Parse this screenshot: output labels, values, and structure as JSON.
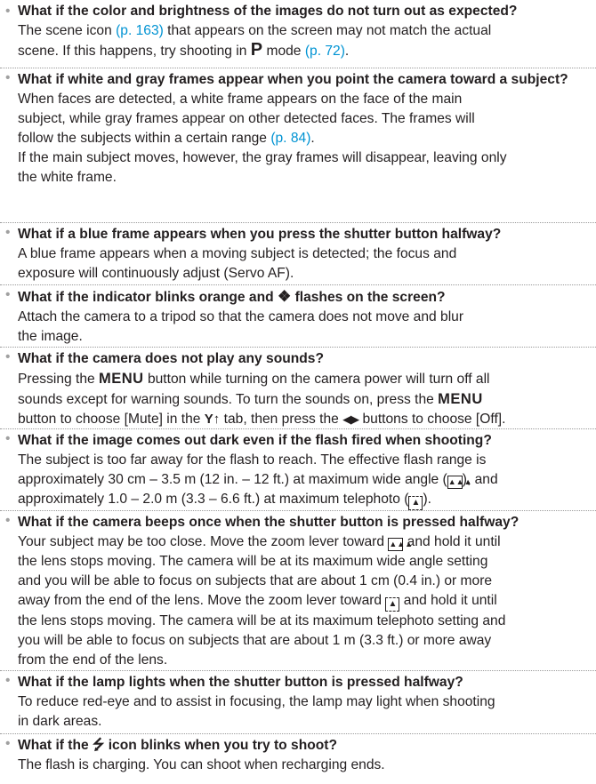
{
  "bullet_glyph": "•",
  "items": [
    {
      "question": "What if the color and brightness of the images do not turn out as expected?",
      "answer_l1_a": "The scene icon ",
      "answer_l1_link": "(p. 163)",
      "answer_l1_b": " that appears on the screen may not match the actual",
      "answer_l2_a": "scene. If this happens, try shooting in ",
      "answer_l2_mode": "P",
      "answer_l2_b": " mode ",
      "answer_l2_link": "(p. 72)",
      "answer_l2_c": "."
    },
    {
      "question": "What if white and gray frames appear when you point the camera toward a subject?",
      "answer_l1": "When faces are detected, a white frame appears on the face of the main",
      "answer_l2": "subject, while gray frames appear on other detected faces. The frames will",
      "answer_l3_a": "follow the subjects within a certain range ",
      "answer_l3_link": "(p. 84)",
      "answer_l3_b": ".",
      "answer_l4": "If the main subject moves, however, the gray frames will disappear, leaving only",
      "answer_l5": "the white frame."
    },
    {
      "question": "What if a blue frame appears when you press the shutter button halfway?",
      "answer_l1": "A blue frame appears when a moving subject is detected; the focus and",
      "answer_l2": "exposure will continuously adjust (Servo AF)."
    },
    {
      "question_a": "What if the indicator blinks orange and ",
      "question_icon": "camera-shake",
      "question_b": " flashes on the screen?",
      "answer_l1": "Attach the camera to a tripod so that the camera does not move and blur",
      "answer_l2": "the image."
    },
    {
      "question": "What if the camera does not play any sounds?",
      "answer_l1_a": "Pressing the ",
      "menu_label": "MENU",
      "answer_l1_b": " button while turning on the camera power will turn off all",
      "answer_l2_a": "sounds except for warning sounds. To turn the sounds on, press the ",
      "answer_l3_a": "button to choose [Mute] in the ",
      "tab_icon": "tools",
      "answer_l3_b": " tab, then press the ",
      "arrows_icon": "left-right",
      "answer_l3_c": " buttons to choose [Off]."
    },
    {
      "question": "What if the image comes out dark even if the flash fired when shooting?",
      "answer_l1": "The subject is too far away for the flash to reach. The effective flash range is",
      "answer_l2_a": "approximately 30 cm – 3.5 m (12 in. – 12 ft.) at maximum wide angle (",
      "answer_l2_b": "), and",
      "answer_l3_a": "approximately 1.0 – 2.0 m (3.3 – 6.6 ft.) at maximum telephoto (",
      "answer_l3_b": ")."
    },
    {
      "question": "What if the camera beeps once when the shutter button is pressed halfway?",
      "answer_l1_a": "Your subject may be too close. Move the zoom lever toward ",
      "answer_l1_b": " and hold it until",
      "answer_l2": "the lens stops moving. The camera will be at its maximum wide angle setting",
      "answer_l3": "and you will be able to focus on subjects that are about 1 cm (0.4 in.) or more",
      "answer_l4_a": "away from the end of the lens. Move the zoom lever toward ",
      "answer_l4_b": " and hold it until",
      "answer_l5": "the lens stops moving. The camera will be at its maximum telephoto setting and",
      "answer_l6": "you will be able to focus on subjects that are about 1 m (3.3 ft.) or more away",
      "answer_l7": "from the end of the lens."
    },
    {
      "question": "What if the lamp lights when the shutter button is pressed halfway?",
      "answer_l1": "To reduce red-eye and to assist in focusing, the lamp may light when shooting",
      "answer_l2": "in dark areas."
    },
    {
      "question_a": "What if the ",
      "question_icon": "flash",
      "question_b": " icon blinks when you try to shoot?",
      "answer_l1": "The flash is charging. You can shoot when recharging ends."
    }
  ],
  "colors": {
    "text": "#231f20",
    "link": "#0093d3",
    "divider": "#9a9a9a"
  }
}
